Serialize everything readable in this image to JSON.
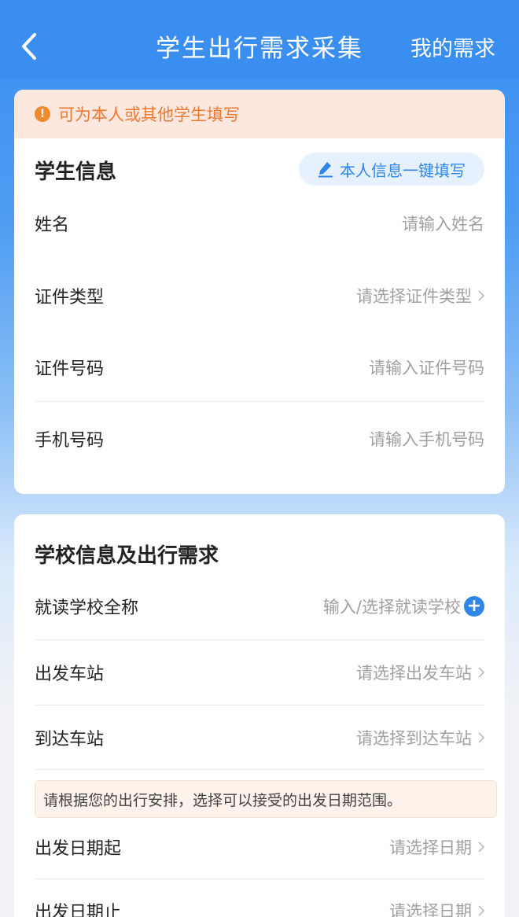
{
  "nav": {
    "title": "学生出行需求采集",
    "right_label": "我的需求"
  },
  "notice": {
    "text": "可为本人或其他学生填写"
  },
  "student": {
    "title": "学生信息",
    "quick_fill": "本人信息一键填写",
    "fields": [
      {
        "label": "姓名",
        "placeholder": "请输入姓名"
      },
      {
        "label": "证件类型",
        "placeholder": "请选择证件类型"
      },
      {
        "label": "证件号码",
        "placeholder": "请输入证件号码"
      },
      {
        "label": "手机号码",
        "placeholder": "请输入手机号码"
      }
    ]
  },
  "school": {
    "title": "学校信息及出行需求",
    "fields": [
      {
        "label": "就读学校全称",
        "placeholder": "输入/选择就读学校"
      },
      {
        "label": "出发车站",
        "placeholder": "请选择出发车站"
      },
      {
        "label": "到达车站",
        "placeholder": "请选择到达车站"
      }
    ],
    "date_tip": "请根据您的出行安排，选择可以接受的出发日期范围。",
    "dates": [
      {
        "label": "出发日期起",
        "placeholder": "请选择日期"
      },
      {
        "label": "出发日期止",
        "placeholder": "请选择日期"
      }
    ]
  },
  "colors": {
    "primary": "#3a8ef0",
    "accent": "#2d86e8",
    "warning": "#ee7a31",
    "notice_bg": "#fde8df"
  }
}
